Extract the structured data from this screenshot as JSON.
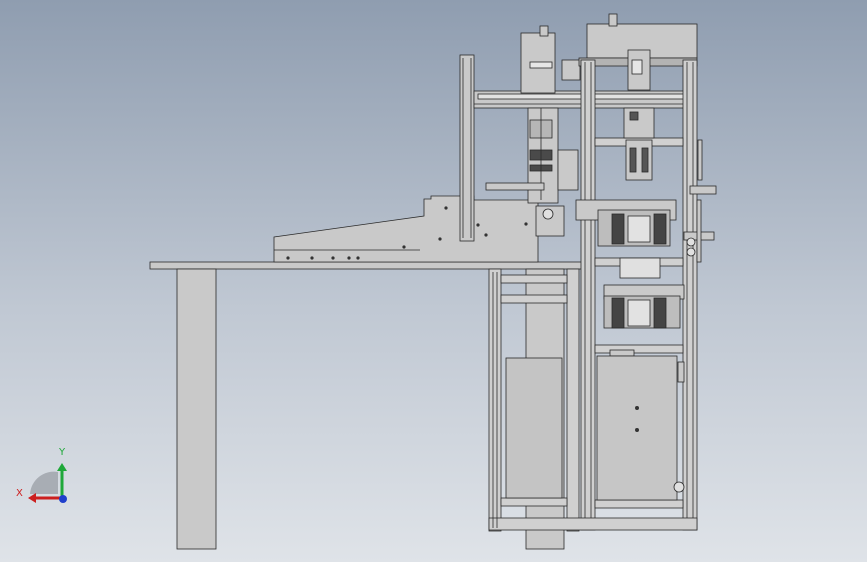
{
  "viewport": {
    "background_top": "#8f9db0",
    "background_bottom": "#dfe3e8"
  },
  "model": {
    "fill": "#c9c9c9",
    "fill_dark": "#a9a9a9",
    "stroke": "#2a2a2a"
  },
  "triad": {
    "x_label": "X",
    "y_label": "Y",
    "x_color": "#cc1f1f",
    "y_color": "#1fa83a",
    "z_color": "#1f3fcc"
  }
}
